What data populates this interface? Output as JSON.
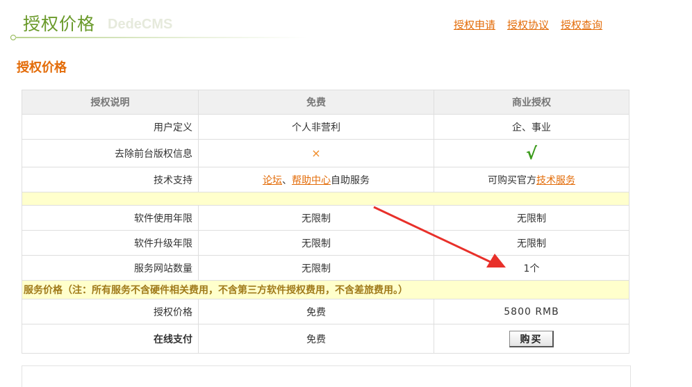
{
  "header": {
    "title": "授权价格",
    "watermark": "DedeCMS",
    "links": [
      "授权申请",
      "授权协议",
      "授权查询"
    ]
  },
  "section_title": "授权价格",
  "table": {
    "headers": [
      "授权说明",
      "免费",
      "商业授权"
    ],
    "rows": [
      {
        "label": "用户定义",
        "free": "个人非营利",
        "commercial": "企、事业"
      },
      {
        "label": "去除前台版权信息",
        "free": "×",
        "commercial": "√"
      },
      {
        "label": "技术支持",
        "free_link1": "论坛",
        "free_sep": "、",
        "free_link2": "帮助中心",
        "free_suffix": "自助服务",
        "commercial_prefix": "可购买官方",
        "commercial_link": "技术服务"
      },
      {
        "label": "软件使用年限",
        "free": "无限制",
        "commercial": "无限制"
      },
      {
        "label": "软件升级年限",
        "free": "无限制",
        "commercial": "无限制"
      },
      {
        "label": "服务网站数量",
        "free": "无限制",
        "commercial": "1个"
      }
    ],
    "note": "服务价格（注：所有服务不含硬件相关费用，不含第三方软件授权费用，不含差旅费用。）",
    "price_row": {
      "label": "授权价格",
      "free": "免费",
      "commercial": "5800 RMB"
    },
    "pay_row": {
      "label": "在线支付",
      "free": "免费",
      "button": "购买"
    }
  },
  "colors": {
    "accent": "#e36c09",
    "brand_green": "#6a9a2a",
    "highlight_row": "#ffffcc",
    "arrow": "#e8302a"
  }
}
